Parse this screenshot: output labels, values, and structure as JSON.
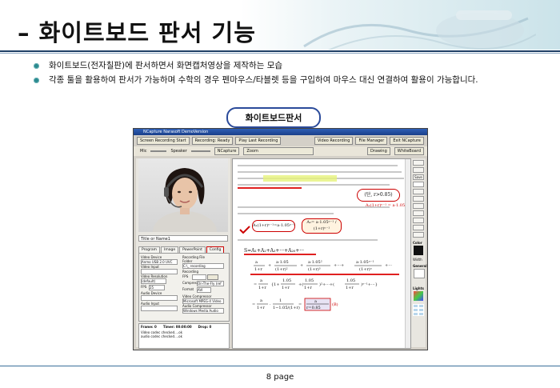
{
  "title": "– 화이트보드 판서 기능",
  "bullets": [
    "화이트보드(전자칠판)에 판서하면서 화면캡처영상을 제작하는 모습",
    "각종 툴을 활용하여 판서가 가능하며 수학의 경우 펜마우스/타블렛 등을 구입하여 마우스 대신 연결하여 활용이 가능합니다."
  ],
  "pill_label": "화이트보드판서",
  "screenshot": {
    "window_title": "NCapture Narasoft DemoVersion",
    "toolbar": {
      "screen_recording_start": "Screen Recording Start",
      "recording_label": "Recording",
      "recording_value": "Ready",
      "play_last_recording": "Play Last Recording",
      "video_recording": "Video Recording",
      "file_manager": "File Manager",
      "exit": "Exit NCapture",
      "mic": "Mic",
      "speaker": "Speaker",
      "ncapture": "NCapture",
      "zoom": "Zoom",
      "drawing": "Drawing",
      "whiteboard": "WhiteBoard"
    },
    "name_field": "Title or Name1",
    "tabs": [
      "Program",
      "Image",
      "PowerPoint",
      "Config"
    ],
    "settings": {
      "video_device": "Video Device",
      "video_device_value": "Anmo USB 2.0 UVC",
      "video_input": "Video Input",
      "video_resolution": "Video Resolution",
      "resolution_value": "(default)",
      "fps_label": "FPS",
      "fps_value": "25",
      "audio_device": "Audio Device",
      "audio_input": "Audio Input",
      "recording_file": "Recording File",
      "folder": "Folder",
      "folder_value": "C:\\_ recording",
      "recording": "Recording",
      "fps2": "FPS",
      "compressor": "Compressor",
      "compressor_value": "On-The-Fly (ref",
      "format": "Format",
      "format_value": "AVI",
      "video_compressor": "Video Compressor",
      "video_compressor_value": "Microsoft MPEG-4 Video",
      "audio_compressor": "Audio Compressor",
      "audio_compressor_value": "Windows Media Audio"
    },
    "status": {
      "frame": "Frame: 0",
      "timer": "Timer: 00:00:00",
      "drop": "Drop: 0",
      "log1": "Video codec checked....ok",
      "log2": "audio codec checked....ok"
    },
    "palette": {
      "save": "Save",
      "color_label": "Color",
      "width_label": "Width",
      "general_label": "General",
      "lights_label": "Lights"
    },
    "doc": {
      "boxed_condition": "(단, r>0.85)",
      "sum_expr": "S=A₁+A₂+A₃+···+A₂₀+···",
      "term1": "A₁(1+r)ⁿ⁻¹=a·1.05ⁿ⁻¹",
      "term2": "A₁= a·1.05ⁿ⁻¹ / (1+r)ⁿ⁻¹",
      "ratio": "r=0.85"
    }
  },
  "page_label": "8 page"
}
